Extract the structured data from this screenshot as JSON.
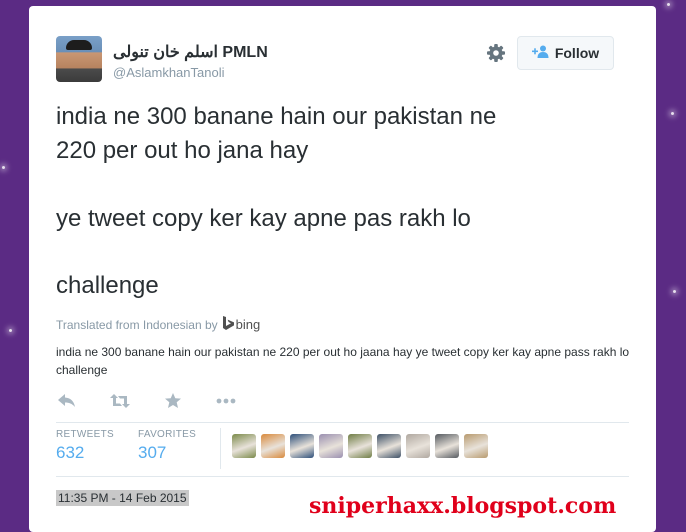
{
  "user": {
    "display_name": "اسلم خان تنولی PMLN",
    "handle": "@AslamkhanTanoli"
  },
  "follow_button": {
    "label": "Follow",
    "icon": "add-user-icon"
  },
  "settings": {
    "icon": "gear-icon"
  },
  "tweet": {
    "lines": [
      "india ne 300 banane hain our pakistan ne",
      "220 per out ho jana hay",
      "ye tweet copy ker kay apne pas rakh lo",
      "challenge"
    ]
  },
  "translation": {
    "label": "Translated from Indonesian by",
    "provider": "bing",
    "text": "india ne 300 banane hain our pakistan ne 220 per out ho jaana hay ye tweet copy ker kay apne pass rakh lo challenge"
  },
  "actions": [
    "reply-icon",
    "retweet-icon",
    "favorite-icon",
    "more-icon"
  ],
  "stats": {
    "retweets_label": "RETWEETS",
    "retweets": "632",
    "favorites_label": "FAVORITES",
    "favorites": "307"
  },
  "favoriters_avatar_colors": [
    "#7b8a4a",
    "#d98a3c",
    "#2d4f7a",
    "#9a8fb0",
    "#6f7d45",
    "#3d5066",
    "#b0a8a0",
    "#555a60",
    "#b89a6e"
  ],
  "timestamp": "11:35 PM - 14 Feb 2015",
  "watermark": "sniperhaxx.blogspot.com",
  "colors": {
    "background": "#5b2b84",
    "link_blue": "#55acee",
    "watermark_red": "#e0001b"
  }
}
